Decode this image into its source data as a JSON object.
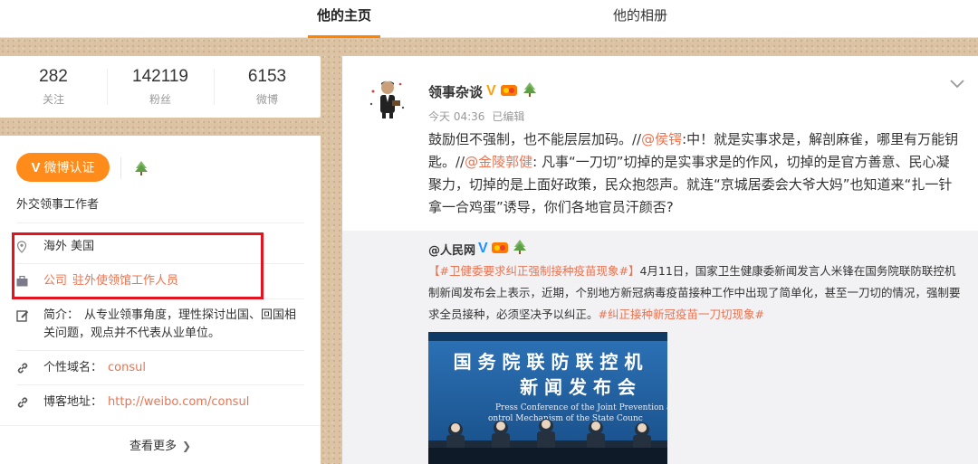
{
  "nav": {
    "tabs": [
      {
        "label": "他的主页",
        "active": true
      },
      {
        "label": "他的相册",
        "active": false
      }
    ]
  },
  "stats": [
    {
      "value": "282",
      "label": "关注"
    },
    {
      "value": "142119",
      "label": "粉丝"
    },
    {
      "value": "6153",
      "label": "微博"
    }
  ],
  "profile": {
    "verify_button": {
      "v": "V",
      "label": "微博认证"
    },
    "verify_text": "外交领事工作者",
    "location": "海外 美国",
    "company_label": "公司",
    "company_value": "驻外使领馆工作人员",
    "bio_label": "简介：",
    "bio_text": "从专业领事角度，理性探讨出国、回国相关问题，观点并不代表从业单位。",
    "domain_label": "个性域名：",
    "domain_value": "consul",
    "blog_label": "博客地址：",
    "blog_value": "http://weibo.com/consul",
    "see_more": "查看更多",
    "highlight_color": "#e5121f"
  },
  "post": {
    "author": "领事杂谈",
    "verified_mark": "V",
    "time": "今天 04:36",
    "edited": "已编辑",
    "text_parts": {
      "p1": "鼓励但不强制，也不能层层加码。//",
      "m1": "@侯锷",
      "p2": ":中！就是实事求是，解剖麻雀，哪里有万能钥匙。//",
      "m2": "@金陵郭健",
      "p3": ": 凡事“一刀切”切掉的是实事求是的作风，切掉的是官方善意、民心凝聚力，切掉的是上面好政策，民众抱怨声。就连“京城居委会大爷大妈”也知道来“扎一针拿一合鸡蛋”诱导，你们各地官员汗颜否?"
    },
    "repost": {
      "author": "@人民网",
      "verified_mark": "V",
      "tag1": "【#卫健委要求纠正强制接种疫苗现象#】",
      "body": "4月11日，国家卫生健康委新闻发言人米锋在国务院联防联控机制新闻发布会上表示，近期，个别地方新冠病毒疫苗接种工作中出现了简单化，甚至一刀切的情况，强制要求全员接种，必须坚决予以纠正。",
      "tag2": "#纠正接种新冠疫苗一刀切现象#",
      "image": {
        "line1": "国 务 院 联 防 联 控 机",
        "line2": "新 闻 发 布 会",
        "line3": "Press Conference of the Joint Prevention a",
        "line4": "ontrol Mechanism of the State Counc"
      }
    }
  },
  "colors": {
    "accent": "#ff8200",
    "link": "#eb7350",
    "verify_bg": "#ff8c1a",
    "v_icon": "#ffa00a"
  }
}
